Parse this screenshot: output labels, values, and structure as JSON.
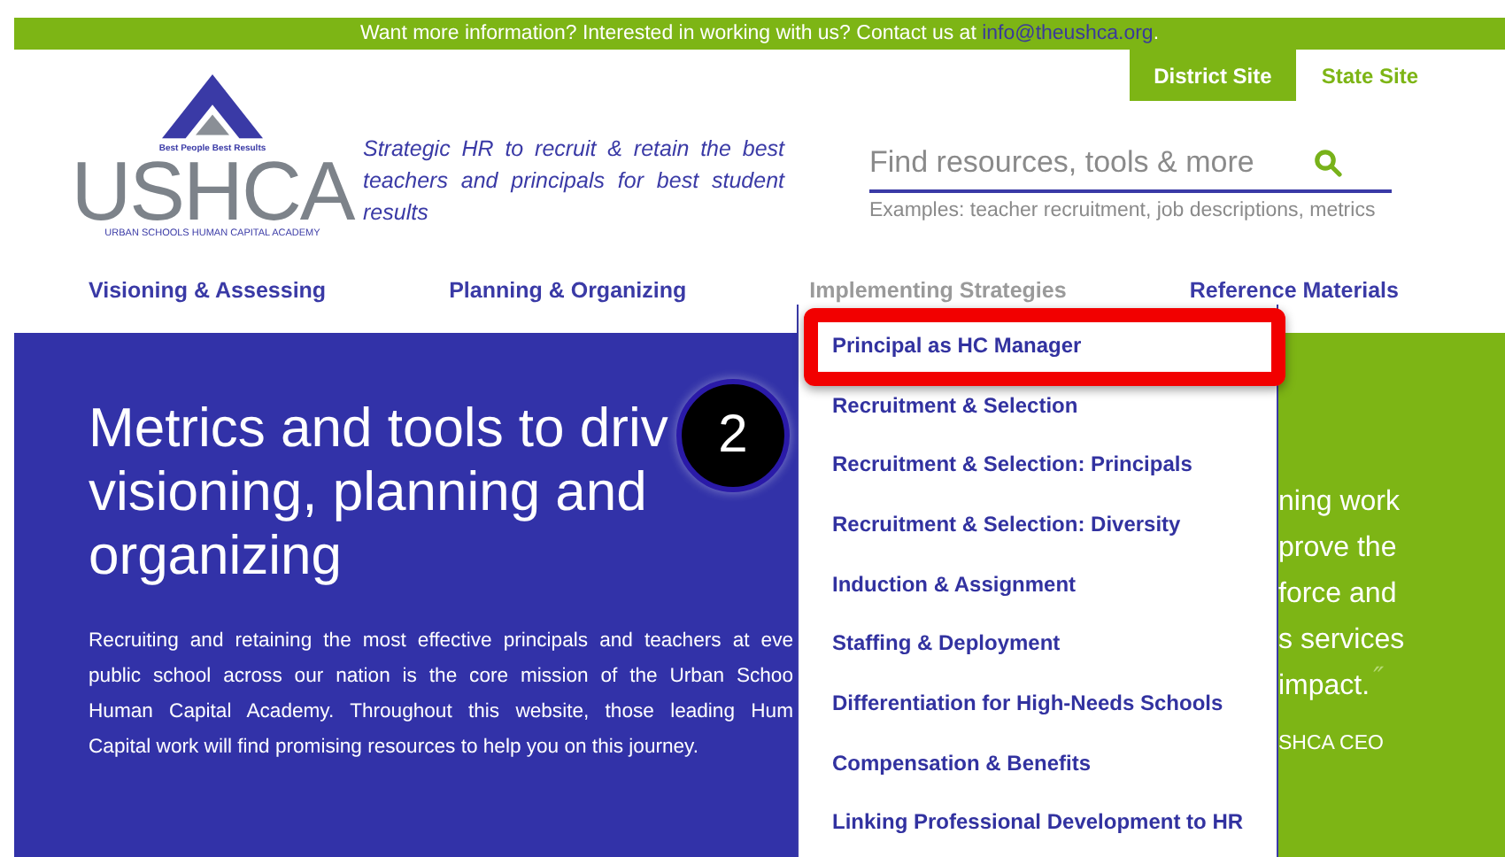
{
  "announcement": {
    "text": "Want more information? Interested in working with us? Contact us at ",
    "email": "info@theushca.org",
    "suffix": "."
  },
  "site_tabs": [
    {
      "label": "District Site",
      "selected": true
    },
    {
      "label": "State Site",
      "selected": false
    }
  ],
  "logo": {
    "tagline": "Best People Best Results",
    "wordmark": "USHCA",
    "subtitle": "URBAN SCHOOLS HUMAN CAPITAL ACADEMY"
  },
  "mission": "Strategic HR to recruit & retain the best teachers and principals for best student results",
  "search": {
    "placeholder": "Find resources, tools & more",
    "hint": "Examples: teacher recruitment, job descriptions, metrics"
  },
  "nav": [
    {
      "label": "Visioning & Assessing",
      "selected": false
    },
    {
      "label": "Planning & Organizing",
      "selected": false
    },
    {
      "label": "Implementing Strategies",
      "selected": true
    },
    {
      "label": "Reference Materials",
      "selected": false
    }
  ],
  "hero": {
    "title_lines": [
      "Metrics and tools to driv",
      "visioning, planning and",
      "organizing"
    ],
    "body_lines": [
      "Recruiting and retaining the most effective principals and teachers at eve",
      "public school across our nation is the core mission of the Urban Schoo",
      "Human Capital Academy. Throughout this website, those leading Hum",
      "Capital work will find promising resources to help you on this journey."
    ]
  },
  "quote": {
    "lines": [
      "ning work",
      "prove the",
      "force and",
      "s services",
      "impact."
    ],
    "close_mark": "″",
    "attribution": "SHCA CEO"
  },
  "dropdown": {
    "items": [
      {
        "label": "Principal as HC Manager",
        "highlighted": true
      },
      {
        "label": "Recruitment & Selection",
        "highlighted": false
      },
      {
        "label": "Recruitment & Selection: Principals",
        "highlighted": false
      },
      {
        "label": "Recruitment & Selection: Diversity",
        "highlighted": false
      },
      {
        "label": "Induction & Assignment",
        "highlighted": false
      },
      {
        "label": "Staffing & Deployment",
        "highlighted": false
      },
      {
        "label": "Differentiation for High-Needs Schools",
        "highlighted": false
      },
      {
        "label": "Compensation & Benefits",
        "highlighted": false
      },
      {
        "label": "Linking Professional Development to HR",
        "highlighted": false
      }
    ]
  },
  "step_badge": "2"
}
